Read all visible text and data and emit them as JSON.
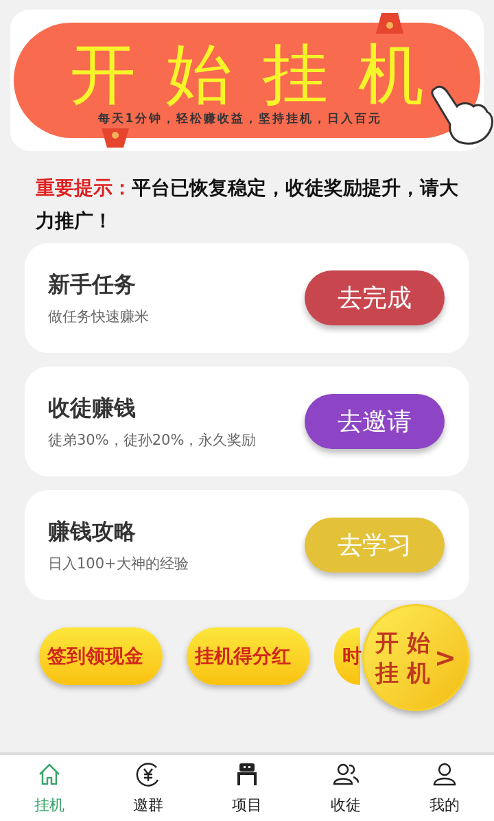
{
  "banner": {
    "title": "开始挂机",
    "subtitle": "每天1分钟，轻松赚收益，坚持挂机，日入百元"
  },
  "notice": {
    "label": "重要提示：",
    "text": "平台已恢复稳定，收徒奖励提升，请大力推广！"
  },
  "tasks": [
    {
      "title": "新手任务",
      "subtitle": "做任务快速赚米",
      "button": "去完成",
      "color": "#c8474f"
    },
    {
      "title": "收徒赚钱",
      "subtitle": "徒弟30%，徒孙20%，永久奖励",
      "button": "去邀请",
      "color": "#8d45c6"
    },
    {
      "title": "赚钱攻略",
      "subtitle": "日入100+大神的经验",
      "button": "去学习",
      "color": "#e3c23a"
    }
  ],
  "quick_buttons": [
    "签到领现金",
    "挂机得分红",
    "时"
  ],
  "float_button": {
    "line_1": "开 始",
    "line_2": "挂 机",
    "arrow": ">"
  },
  "tabs": [
    {
      "label": "挂机",
      "kind": "home",
      "selected": true
    },
    {
      "label": "邀群",
      "kind": "coin",
      "selected": false
    },
    {
      "label": "项目",
      "kind": "robot",
      "selected": false
    },
    {
      "label": "收徒",
      "kind": "users",
      "selected": false
    },
    {
      "label": "我的",
      "kind": "user",
      "selected": false
    }
  ]
}
